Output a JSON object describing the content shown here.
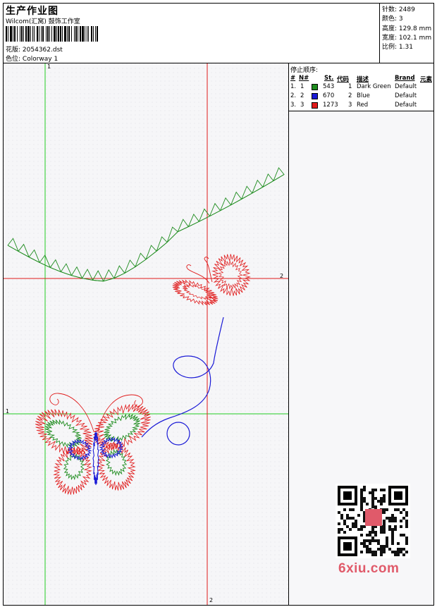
{
  "header": {
    "title": "生产作业图",
    "company": "Wilcom(汇窝) 鼓饰工作室",
    "design_label": "花版:",
    "design_value": "2054362.dst",
    "colorway_label": "色位:",
    "colorway_value": "Colorway 1"
  },
  "stats": [
    {
      "label": "针数:",
      "value": "2489"
    },
    {
      "label": "颜色:",
      "value": "3"
    },
    {
      "label": "高度:",
      "value": "129.8 mm"
    },
    {
      "label": "宽度:",
      "value": "102.1 mm"
    },
    {
      "label": "比例:",
      "value": "1.31"
    }
  ],
  "stop_sequence": {
    "title": "停止顺序:",
    "columns": [
      "#",
      "N#",
      "St.",
      "代码",
      "描述",
      "Brand",
      "元素"
    ],
    "rows": [
      {
        "num": "1.",
        "n": "1",
        "color": "#1e8c1e",
        "st": "543",
        "code": "1",
        "desc": "Dark Green",
        "brand": "Default"
      },
      {
        "num": "2.",
        "n": "2",
        "color": "#1a1ad6",
        "st": "670",
        "code": "2",
        "desc": "Blue",
        "brand": "Default"
      },
      {
        "num": "3.",
        "n": "3",
        "color": "#e01a1a",
        "st": "1273",
        "code": "3",
        "desc": "Red",
        "brand": "Default"
      }
    ]
  },
  "axis_labels": {
    "v1": "1",
    "v2": "2",
    "h1": "1",
    "h2": "2"
  },
  "watermark": "6xiu.com",
  "colors": {
    "green": "#1e8c1e",
    "blue": "#1a1ad6",
    "red": "#e01a1a",
    "guide_green": "#22cc22",
    "guide_red": "#e01a1a"
  }
}
